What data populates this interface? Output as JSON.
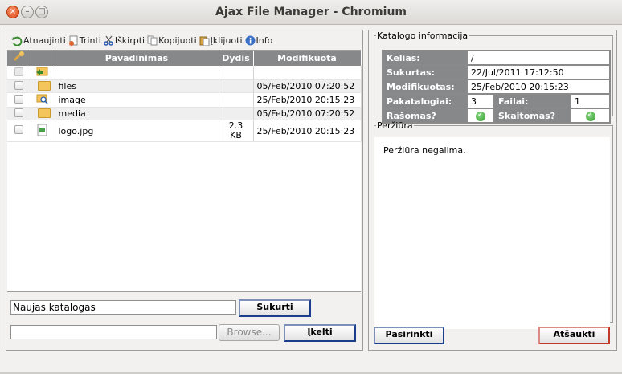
{
  "window": {
    "title": "Ajax File Manager - Chromium"
  },
  "toolbar": {
    "items": [
      {
        "label": "Atnaujinti",
        "icon": "refresh-icon"
      },
      {
        "label": "Trinti",
        "icon": "delete-icon"
      },
      {
        "label": "Iškirpti",
        "icon": "cut-icon"
      },
      {
        "label": "Kopijuoti",
        "icon": "copy-icon"
      },
      {
        "label": "Įklijuoti",
        "icon": "paste-icon"
      },
      {
        "label": "Info",
        "icon": "info-icon"
      }
    ]
  },
  "file_table": {
    "columns": [
      "Pavadinimas",
      "Dydis",
      "Modifikuota"
    ],
    "rows": [
      {
        "name": "",
        "size": "",
        "modified": "",
        "type": "parent-folder"
      },
      {
        "name": "files",
        "size": "",
        "modified": "05/Feb/2010 07:20:52",
        "type": "folder"
      },
      {
        "name": "image",
        "size": "",
        "modified": "25/Feb/2010 20:15:23",
        "type": "folder"
      },
      {
        "name": "media",
        "size": "",
        "modified": "05/Feb/2010 07:20:52",
        "type": "folder"
      },
      {
        "name": "logo.jpg",
        "size": "2.3 KB",
        "size_line1": "2.3",
        "size_line2": "KB",
        "modified": "25/Feb/2010 20:15:23",
        "type": "image"
      }
    ]
  },
  "new_folder": {
    "value": "Naujas katalogas",
    "button": "Sukurti"
  },
  "upload": {
    "value": "",
    "browse": "Browse...",
    "button": "Įkelti"
  },
  "info": {
    "legend": "Katalogo informacija",
    "path_label": "Kelias:",
    "path_value": "/",
    "created_label": "Sukurtas:",
    "created_value": "22/Jul/2011 17:12:50",
    "modified_label": "Modifikuotas:",
    "modified_value": "25/Feb/2010 20:15:23",
    "subfolders_label": "Pakatalogiai:",
    "subfolders_value": "3",
    "files_label": "Failai:",
    "files_value": "1",
    "writable_label": "Rašomas?",
    "readable_label": "Skaitomas?"
  },
  "preview": {
    "legend": "Peržiūra",
    "text": "Peržiūra negalima."
  },
  "actions": {
    "select": "Pasirinkti",
    "cancel": "Atšaukti"
  },
  "colors": {
    "header_gray": "#87888a",
    "accent_blue": "#1b3e8a",
    "cancel_red": "#c0392b"
  }
}
